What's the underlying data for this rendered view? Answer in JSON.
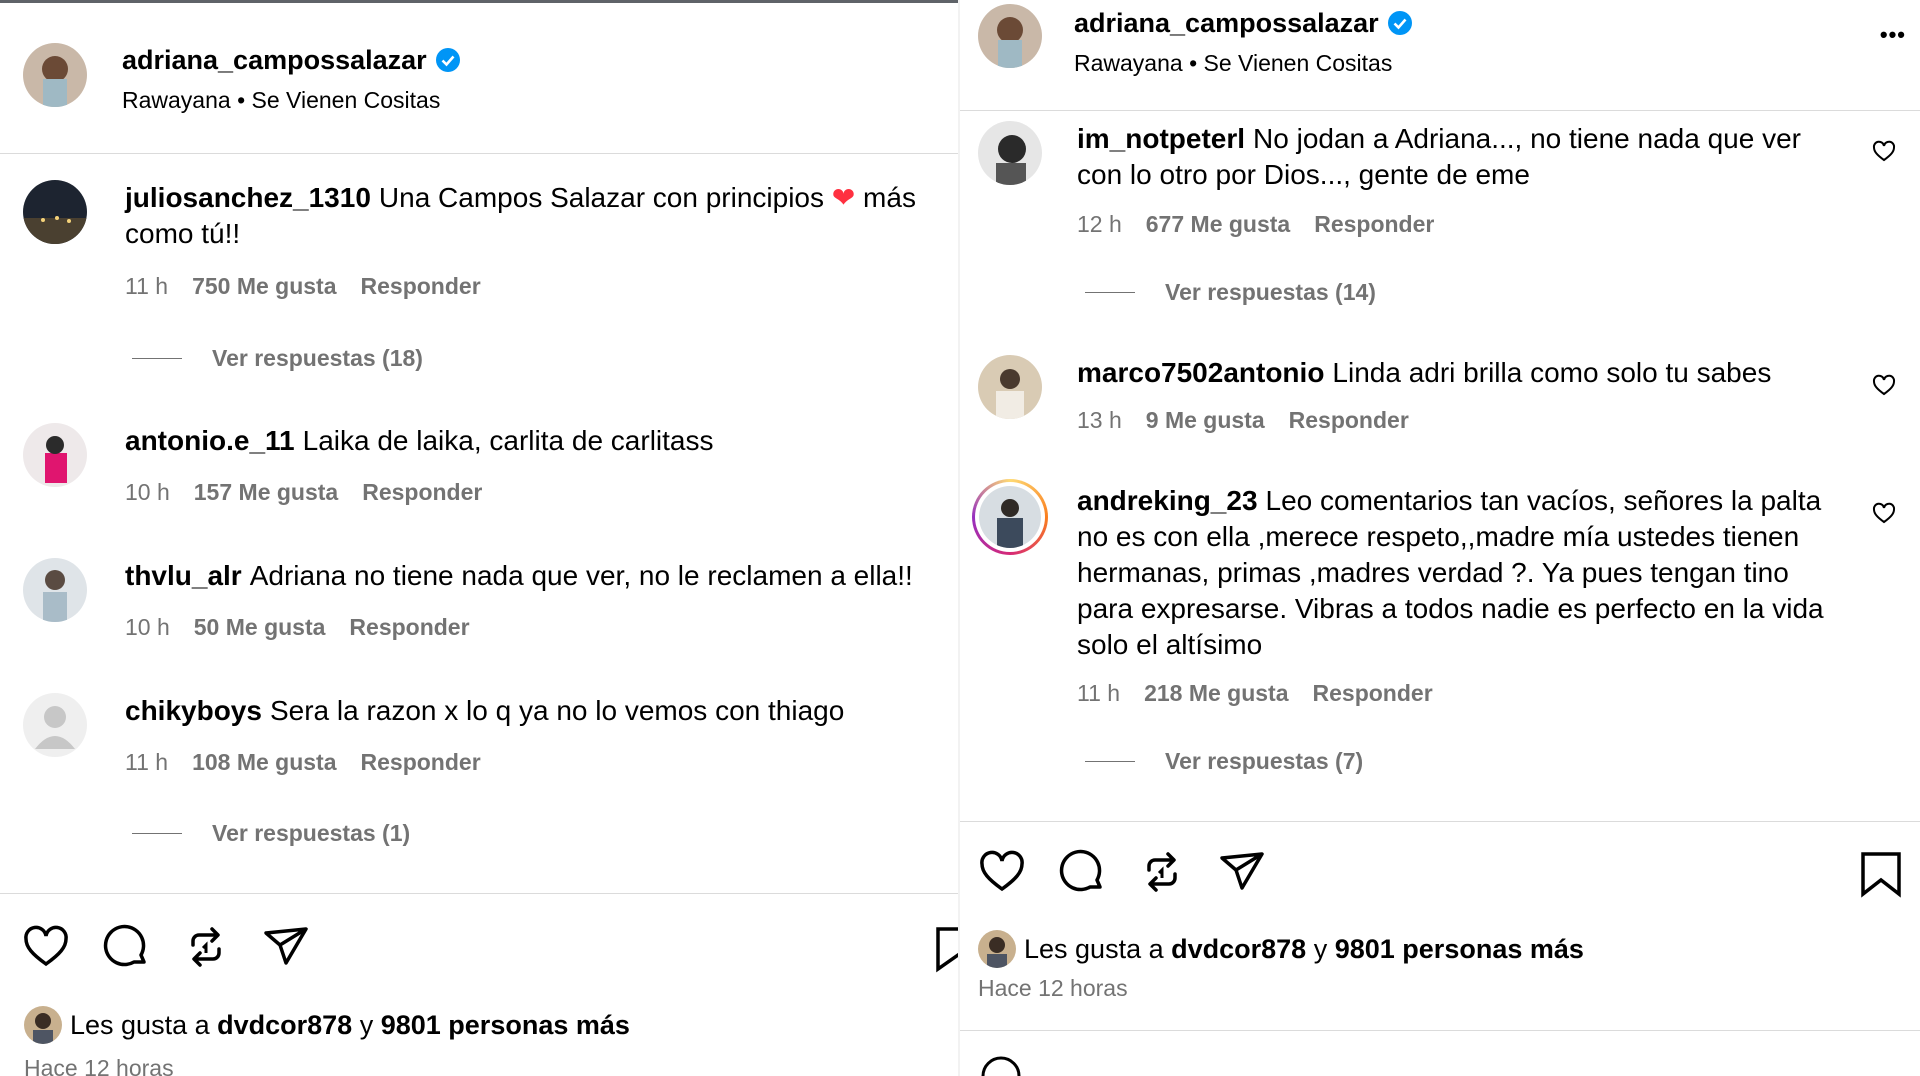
{
  "post": {
    "username": "adriana_campossalazar",
    "verified": true,
    "subline": "Rawayana • Se Vienen Cositas",
    "likes_prefix": "Les gusta a",
    "likes_user": "dvdcor878",
    "likes_conj": "y",
    "likes_rest": "9801 personas más",
    "time": "Hace 12 horas",
    "more_menu": "•••"
  },
  "left_comments": [
    {
      "user": "juliosanchez_1310",
      "text_a": "Una Campos Salazar con principios",
      "emoji": "❤",
      "text_b": "más como tú!!",
      "time": "11 h",
      "likes": "750 Me gusta",
      "reply": "Responder",
      "replies": "Ver respuestas (18)"
    },
    {
      "user": "antonio.e_11",
      "text": "Laika de laika, carlita de carlitass",
      "time": "10 h",
      "likes": "157 Me gusta",
      "reply": "Responder"
    },
    {
      "user": "thvlu_alr",
      "text": "Adriana no tiene nada que ver, no le reclamen a ella!!",
      "time": "10 h",
      "likes": "50 Me gusta",
      "reply": "Responder"
    },
    {
      "user": "chikyboys",
      "text": "Sera la razon x lo q ya no lo vemos con thiago",
      "time": "11 h",
      "likes": "108 Me gusta",
      "reply": "Responder",
      "replies": "Ver respuestas (1)"
    }
  ],
  "right_comments": [
    {
      "user": "im_notpeterl",
      "text": "No jodan a Adriana..., no tiene nada que ver con lo otro por Dios..., gente de eme",
      "time": "12 h",
      "likes": "677 Me gusta",
      "reply": "Responder",
      "replies": "Ver respuestas (14)"
    },
    {
      "user": "marco7502antonio",
      "text": "Linda adri brilla como solo tu sabes",
      "time": "13 h",
      "likes": "9 Me gusta",
      "reply": "Responder"
    },
    {
      "user": "andreking_23",
      "text": "Leo comentarios tan vacíos, señores la palta no es con ella ,merece respeto,,madre mía ustedes tienen hermanas, primas ,madres verdad ?. Ya pues tengan tino para expresarse. Vibras a todos nadie es perfecto en la vida solo el altísimo",
      "time": "11 h",
      "likes": "218 Me gusta",
      "reply": "Responder",
      "replies": "Ver respuestas (7)"
    }
  ],
  "colors": {
    "accent": "#0095f6",
    "muted": "#737373",
    "divider": "#dbdbdb",
    "heart": "#ff3040"
  },
  "icons": [
    "heart-icon",
    "comment-icon",
    "repost-icon",
    "share-icon",
    "bookmark-icon",
    "verified-icon",
    "more-icon"
  ]
}
